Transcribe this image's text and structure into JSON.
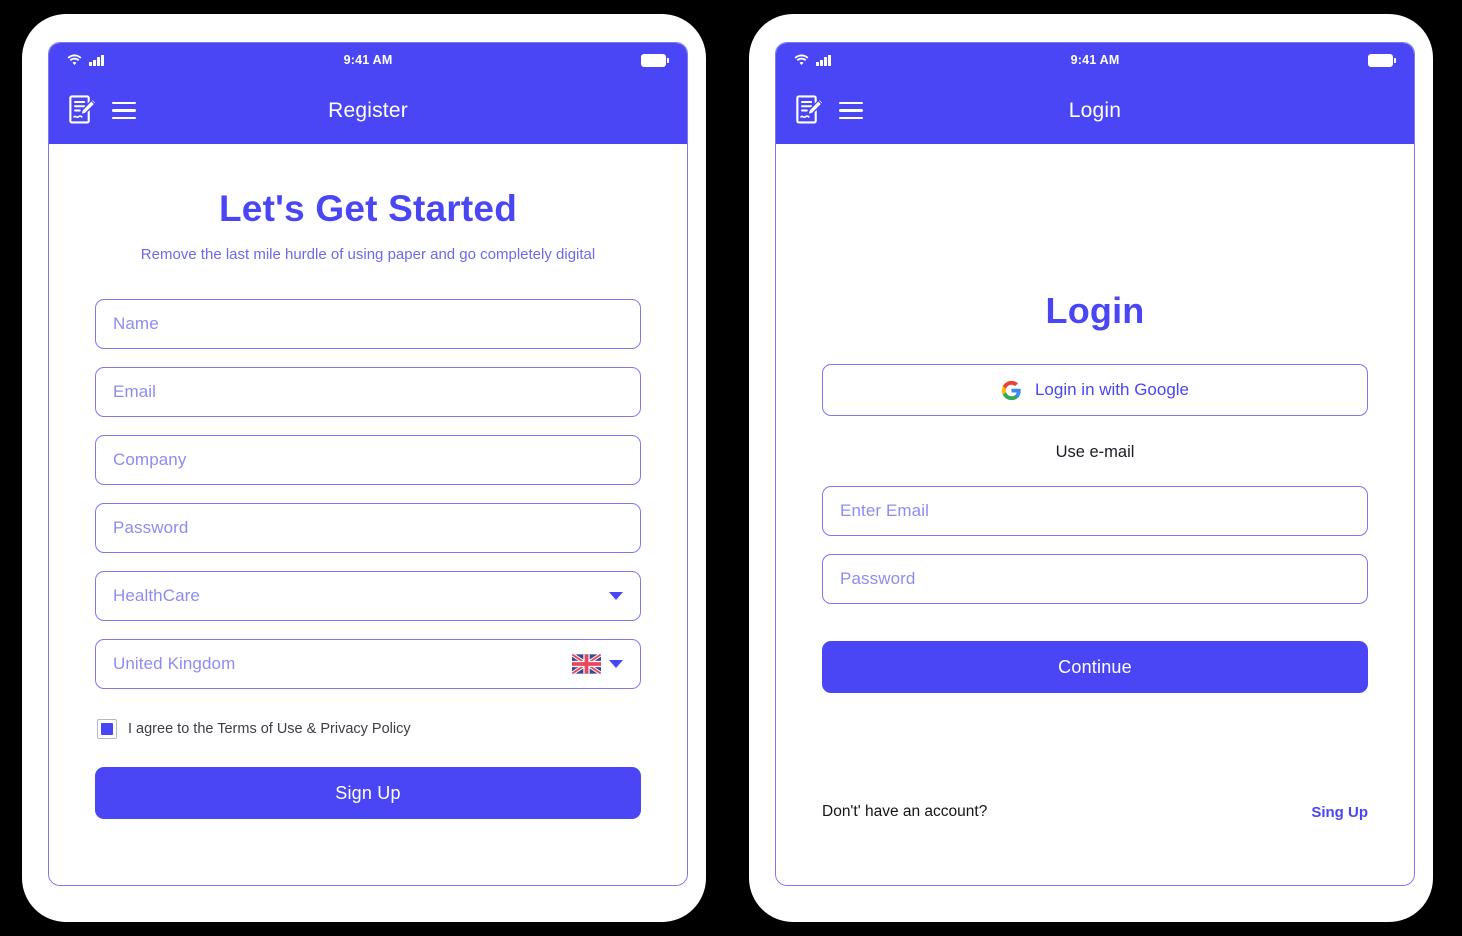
{
  "theme": {
    "accent": "#4a46f5",
    "field_border": "#7b78f0",
    "placeholder": "#8e8cf2",
    "subtext": "#6d6ae8",
    "page_background": "#000000",
    "frame": "#ffffff"
  },
  "register_screen": {
    "status_bar": {
      "time": "9:41 AM",
      "wifi_icon": "wifi-icon",
      "signal_icon": "cellular-signal-icon",
      "battery_icon": "battery-icon"
    },
    "app_bar": {
      "logo_icon": "document-pen-icon",
      "menu_icon": "hamburger-menu-icon",
      "title": "Register"
    },
    "headline": "Let's Get Started",
    "subheadline": "Remove the last mile hurdle of using paper and go completely digital",
    "fields": [
      {
        "name": "name",
        "placeholder": "Name",
        "type": "text"
      },
      {
        "name": "email",
        "placeholder": "Email",
        "type": "text"
      },
      {
        "name": "company",
        "placeholder": "Company",
        "type": "text"
      },
      {
        "name": "password",
        "placeholder": "Password",
        "type": "password"
      },
      {
        "name": "industry",
        "placeholder": "HealthCare",
        "type": "select"
      },
      {
        "name": "country",
        "placeholder": "United Kingdom",
        "type": "select-flag"
      }
    ],
    "industry_caret_icon": "chevron-down-icon",
    "country_flag_icon": "united-kingdom-flag-icon",
    "country_caret_icon": "chevron-down-icon",
    "terms": {
      "checked": true,
      "label": "I agree to the Terms of Use & Privacy Policy"
    },
    "submit_label": "Sign Up"
  },
  "login_screen": {
    "status_bar": {
      "time": "9:41 AM",
      "wifi_icon": "wifi-icon",
      "signal_icon": "cellular-signal-icon",
      "battery_icon": "battery-icon"
    },
    "app_bar": {
      "logo_icon": "document-pen-icon",
      "menu_icon": "hamburger-menu-icon",
      "title": "Login"
    },
    "title": "Login",
    "google_button": {
      "icon": "google-logo-icon",
      "label": "Login in with Google"
    },
    "divider_label": "Use e-mail",
    "fields": [
      {
        "name": "email",
        "placeholder": "Enter Email",
        "type": "text"
      },
      {
        "name": "password",
        "placeholder": "Password",
        "type": "password"
      }
    ],
    "submit_label": "Continue",
    "footer": {
      "question": "Don't' have an account?",
      "link": "Sing Up"
    }
  }
}
